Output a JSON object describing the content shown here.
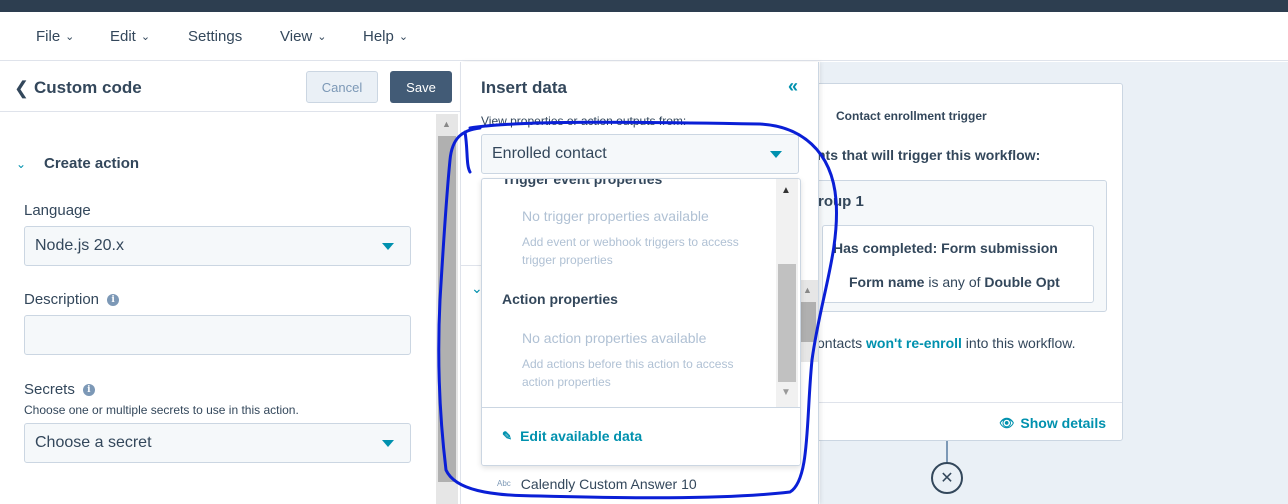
{
  "menubar": {
    "items": [
      {
        "label": "File",
        "has_chevron": true
      },
      {
        "label": "Edit",
        "has_chevron": true
      },
      {
        "label": "Settings",
        "has_chevron": false
      },
      {
        "label": "View",
        "has_chevron": true
      },
      {
        "label": "Help",
        "has_chevron": true
      }
    ]
  },
  "left_panel": {
    "title": "Custom code",
    "cancel_label": "Cancel",
    "save_label": "Save",
    "section_title": "Create action",
    "language": {
      "label": "Language",
      "value": "Node.js 20.x"
    },
    "description": {
      "label": "Description",
      "value": ""
    },
    "secrets": {
      "label": "Secrets",
      "help": "Choose one or multiple secrets to use in this action.",
      "placeholder": "Choose a secret"
    }
  },
  "insert_panel": {
    "title": "Insert data",
    "collapse_glyph": "«",
    "source_label": "View properties or action outputs from:",
    "source_value": "Enrolled contact",
    "dropdown": {
      "cut_heading": "Trigger event properties",
      "trigger_empty": "No trigger properties available",
      "trigger_hint": "Add event or webhook triggers to access trigger properties",
      "action_heading": "Action properties",
      "action_empty": "No action properties available",
      "action_hint": "Add actions before this action to access action properties",
      "edit_label": "Edit available data"
    },
    "background_item": {
      "type_tag": "Abc",
      "label": "Calendly Custom Answer 10"
    }
  },
  "trigger_card": {
    "title": "Contact enrollment trigger",
    "subtitle": "nts that will trigger this workflow:",
    "group_title": "roup 1",
    "condition_line1": "Has completed: Form submission",
    "condition_field": "Form name",
    "condition_op": " is any of ",
    "condition_value": "Double Opt",
    "reenroll_prefix": "ontacts ",
    "reenroll_link": "won't re-enroll",
    "reenroll_suffix": " into this workflow.",
    "show_details": "Show details"
  },
  "icons": {
    "back": "chevron-left-icon",
    "collapse": "double-chevron-left-icon",
    "info": "info-icon",
    "eye": "eye-icon",
    "pencil": "pencil-icon",
    "end": "close-circle-icon"
  },
  "colors": {
    "accent": "#0091ae",
    "primary_button": "#425b76",
    "text": "#33475b",
    "annotation": "#0a1fd6"
  }
}
